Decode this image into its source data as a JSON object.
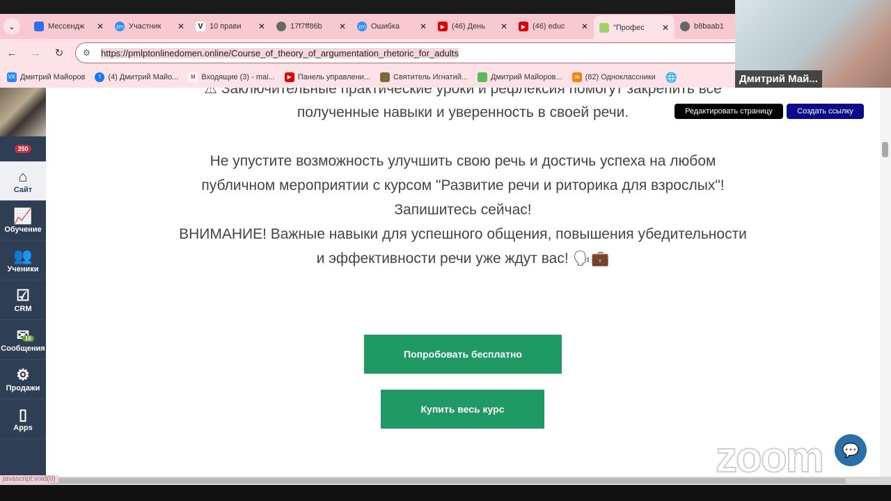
{
  "browser": {
    "tabs": [
      {
        "label": "Мессендж",
        "icon": "messenger-icon",
        "color": "#2b6ef3"
      },
      {
        "label": "Участник",
        "icon": "zoom-icon",
        "color": "#2d8cff"
      },
      {
        "label": "10 прави",
        "icon": "v-icon",
        "color": "#111111"
      },
      {
        "label": "17f7ff86b",
        "icon": "globe-icon",
        "color": "#555555"
      },
      {
        "label": "Ошибка",
        "icon": "zoom-icon",
        "color": "#2d8cff"
      },
      {
        "label": "(46) День",
        "icon": "youtube-icon",
        "color": "#e00000"
      },
      {
        "label": "(46) educ",
        "icon": "youtube-icon",
        "color": "#e00000"
      },
      {
        "label": "\"Профес",
        "icon": "site-icon",
        "color": "#9fd36a"
      },
      {
        "label": "b8baab1",
        "icon": "globe-icon",
        "color": "#555555"
      }
    ],
    "url": "https://pmlptonlinedomen.online/Course_of_theory_of_argumentation_rhetoric_for_adults",
    "bookmarks": [
      {
        "label": "Дмитрий Майоров",
        "color": "#2787f5"
      },
      {
        "label": "(4) Дмитрий Майо...",
        "color": "#1877f2"
      },
      {
        "label": "Входящие (3) - mai...",
        "color": "#d93025"
      },
      {
        "label": "Панель управлени...",
        "color": "#e00000"
      },
      {
        "label": "Святитель Игнатий...",
        "color": "#7a6a3a"
      },
      {
        "label": "Дмитрий Майоров...",
        "color": "#5cb85c"
      },
      {
        "label": "(82) Одноклассники",
        "color": "#ee8208"
      }
    ]
  },
  "video": {
    "name": "Дмитрий Май..."
  },
  "sidebar": {
    "badge": "350",
    "items": [
      {
        "label": "Сайт",
        "icon": "home-icon"
      },
      {
        "label": "Обучение",
        "icon": "chart-icon"
      },
      {
        "label": "Ученики",
        "icon": "users-icon"
      },
      {
        "label": "CRM",
        "icon": "checkbox-icon"
      },
      {
        "label": "Сообщения",
        "icon": "mail-icon",
        "badge": "16"
      },
      {
        "label": "Продажи",
        "icon": "safe-icon"
      },
      {
        "label": "Apps",
        "icon": "phone-icon"
      }
    ]
  },
  "content": {
    "line_cut": "⚠ Заключительные практические уроки и рефлексия помогут закрепить все",
    "line1": "полученные навыки и уверенность в своей речи.",
    "p2": [
      "Не упустите возможность улучшить свою речь и достичь успеха на любом",
      "публичном мероприятии с курсом \"Развитие речи и риторика для взрослых\"!",
      "Запишитесь сейчас!",
      "ВНИМАНИЕ! Важные навыки для успешного общения, повышения убедительности",
      "и эффективности речи уже ждут вас! 🗣💼"
    ],
    "edit_page": "Редактировать страницу",
    "create_link": "Создать ссылку",
    "try_free": "Попробовать бесплатно",
    "buy_course": "Купить весь курс"
  },
  "status_text": "javascript:void(0)",
  "zoom_watermark": "zoom"
}
